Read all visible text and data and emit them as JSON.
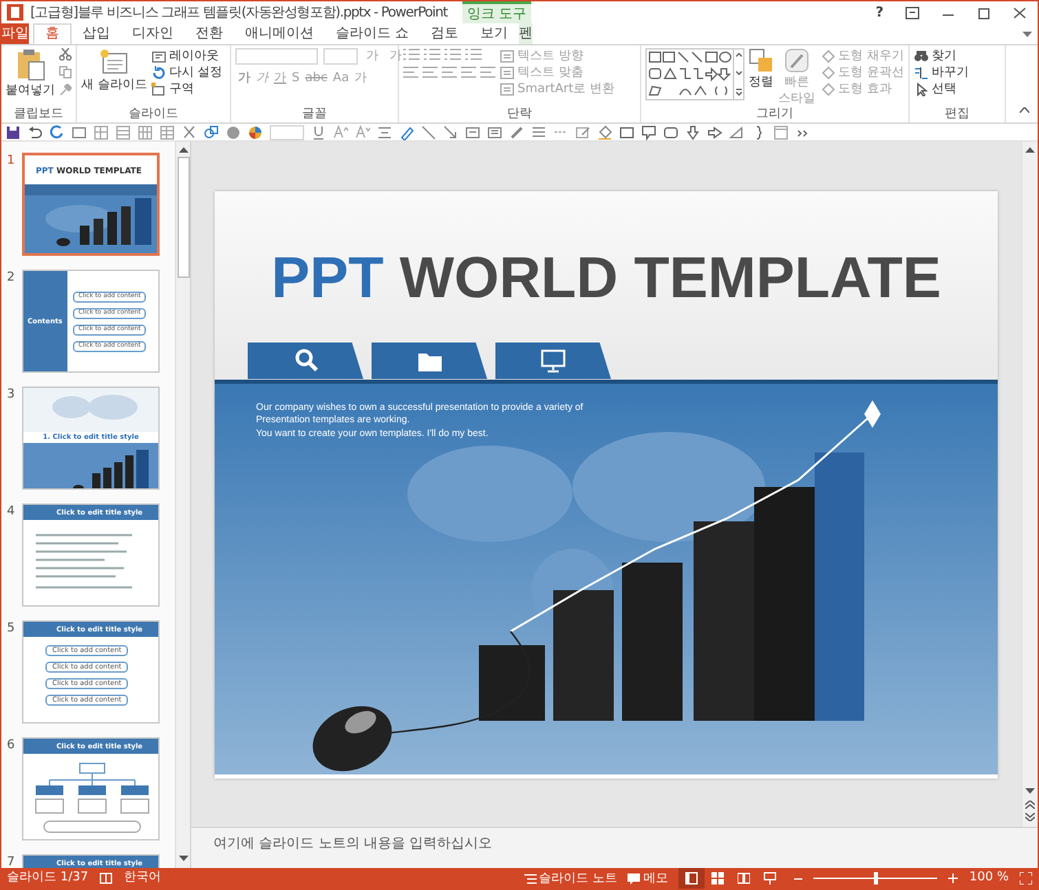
{
  "window": {
    "title": "[고급형]블루 비즈니스 그래프 템플릿(자동완성형포함).pptx - PowerPoint",
    "context_group": "잉크 도구",
    "help": "?"
  },
  "tabs": [
    {
      "label": "파일",
      "kind": "file",
      "selected": false
    },
    {
      "label": "홈",
      "kind": "normal",
      "selected": true
    },
    {
      "label": "삽입",
      "kind": "normal",
      "selected": false
    },
    {
      "label": "디자인",
      "kind": "normal",
      "selected": false
    },
    {
      "label": "전환",
      "kind": "normal",
      "selected": false
    },
    {
      "label": "애니메이션",
      "kind": "normal",
      "selected": false
    },
    {
      "label": "슬라이드 쇼",
      "kind": "normal",
      "selected": false
    },
    {
      "label": "검토",
      "kind": "normal",
      "selected": false
    },
    {
      "label": "보기",
      "kind": "normal",
      "selected": false
    },
    {
      "label": "펜",
      "kind": "context",
      "selected": false
    }
  ],
  "ribbon": {
    "groups": [
      {
        "label": "클립보드",
        "kind": "clipboard",
        "buttons": [
          {
            "label": "붙여넣기",
            "kind": "large",
            "disabled": false
          }
        ]
      },
      {
        "label": "슬라이드",
        "kind": "slides",
        "buttons": [
          {
            "label": "새 슬라이드",
            "kind": "large",
            "disabled": false
          },
          {
            "label": "레이아웃",
            "kind": "small",
            "disabled": false
          },
          {
            "label": "다시 설정",
            "kind": "small",
            "disabled": false
          },
          {
            "label": "구역",
            "kind": "small",
            "disabled": false
          }
        ]
      },
      {
        "label": "글꼴",
        "kind": "font",
        "size_buttons": [
          "가",
          "가"
        ],
        "format_buttons": [
          "가",
          "가",
          "가",
          "S",
          "abc",
          "Aa",
          "가"
        ]
      },
      {
        "label": "단락",
        "kind": "paragraph",
        "buttons": [
          {
            "label": "텍스트 방향",
            "kind": "small",
            "disabled": true
          },
          {
            "label": "텍스트 맞춤",
            "kind": "small",
            "disabled": true
          },
          {
            "label": "SmartArt로 변환",
            "kind": "small",
            "disabled": true
          }
        ]
      },
      {
        "label": "그리기",
        "kind": "drawing",
        "buttons": [
          {
            "label": "정렬",
            "kind": "large",
            "disabled": false
          },
          {
            "label": "빠른 스타일",
            "kind": "large",
            "disabled": true
          },
          {
            "label": "도형 채우기",
            "kind": "small",
            "disabled": true
          },
          {
            "label": "도형 윤곽선",
            "kind": "small",
            "disabled": true
          },
          {
            "label": "도형 효과",
            "kind": "small",
            "disabled": true
          }
        ]
      },
      {
        "label": "편집",
        "kind": "editing",
        "buttons": [
          {
            "label": "찾기",
            "kind": "small",
            "disabled": false
          },
          {
            "label": "바꾸기",
            "kind": "small",
            "disabled": false
          },
          {
            "label": "선택",
            "kind": "small",
            "disabled": false
          }
        ]
      }
    ]
  },
  "thumbnails": [
    {
      "number": "1",
      "kind": "cover",
      "selected": true,
      "accent": "PPT",
      "title": "WORLD TEMPLATE"
    },
    {
      "number": "2",
      "kind": "contents",
      "selected": false,
      "title": "Contents",
      "items": [
        "Click to add content",
        "Click to add content",
        "Click to add content",
        "Click to add content"
      ]
    },
    {
      "number": "3",
      "kind": "map",
      "selected": false,
      "title": "1. Click to edit title style"
    },
    {
      "number": "4",
      "kind": "text",
      "selected": false,
      "title": "Click to edit title style"
    },
    {
      "number": "5",
      "kind": "list",
      "selected": false,
      "title": "Click to edit title style",
      "items": [
        "Click to add content",
        "Click to add content",
        "Click to add content",
        "Click to add content"
      ]
    },
    {
      "number": "6",
      "kind": "org",
      "selected": false,
      "title": "Click to edit title style"
    },
    {
      "number": "7",
      "kind": "header",
      "selected": false,
      "title": "Click to edit title style"
    }
  ],
  "slide": {
    "accent": "PPT",
    "title": "WORLD TEMPLATE",
    "body": [
      "Our company wishes to own a successful presentation to provide a variety of Presentation templates are working.",
      "You want to create your own templates. I'll do my best."
    ]
  },
  "notes": {
    "placeholder": "여기에 슬라이드 노트의 내용을 입력하십시오"
  },
  "status_bar": {
    "slide": "슬라이드 1/37",
    "language": "한국어",
    "notes": "슬라이드 노트",
    "comments": "메모",
    "views": [
      {
        "selected": true
      },
      {
        "selected": false
      },
      {
        "selected": false
      },
      {
        "selected": false
      }
    ],
    "zoom_slider": {
      "level": 0.5
    },
    "zoom": "100 %"
  }
}
